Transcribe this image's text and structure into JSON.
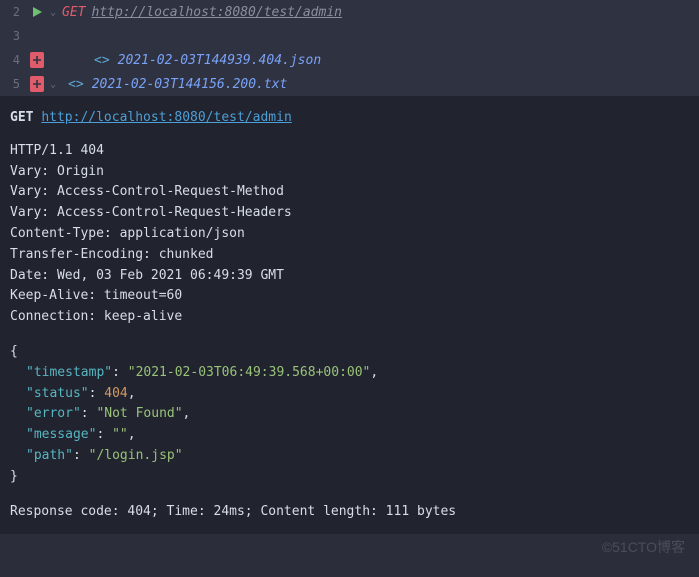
{
  "editor": {
    "lines": {
      "l2": 2,
      "l3": 3,
      "l4": 4,
      "l5": 5
    },
    "request": {
      "method": "GET",
      "url": "http://localhost:8080/test/admin"
    },
    "files": [
      "2021-02-03T144939.404.json",
      "2021-02-03T144156.200.txt"
    ]
  },
  "response": {
    "method": "GET",
    "url": "http://localhost:8080/test/admin",
    "status_line": "HTTP/1.1 404 ",
    "headers": [
      "Vary: Origin",
      "Vary: Access-Control-Request-Method",
      "Vary: Access-Control-Request-Headers",
      "Content-Type: application/json",
      "Transfer-Encoding: chunked",
      "Date: Wed, 03 Feb 2021 06:49:39 GMT",
      "Keep-Alive: timeout=60",
      "Connection: keep-alive"
    ],
    "body": {
      "timestamp_k": "\"timestamp\"",
      "timestamp_v": "\"2021-02-03T06:49:39.568+00:00\"",
      "status_k": "\"status\"",
      "status_v": "404",
      "error_k": "\"error\"",
      "error_v": "\"Not Found\"",
      "message_k": "\"message\"",
      "message_v": "\"\"",
      "path_k": "\"path\"",
      "path_v": "\"/login.jsp\""
    },
    "footer": "Response code: 404; Time: 24ms; Content length: 111 bytes"
  },
  "watermark": "©51CTO博客"
}
